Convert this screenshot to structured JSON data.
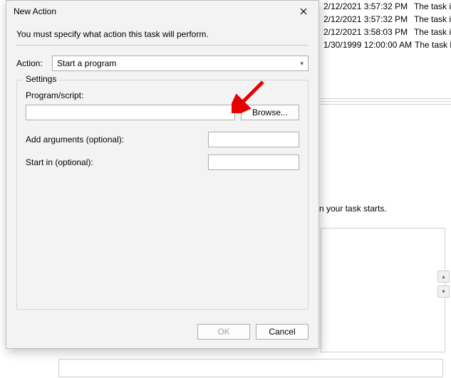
{
  "dialog": {
    "title": "New Action",
    "instruction": "You must specify what action this task will perform.",
    "action_label": "Action:",
    "action_value": "Start a program",
    "settings_legend": "Settings",
    "program_label": "Program/script:",
    "program_value": "",
    "browse_label": "Browse...",
    "arguments_label": "Add arguments (optional):",
    "arguments_value": "",
    "startin_label": "Start in (optional):",
    "startin_value": "",
    "ok_label": "OK",
    "cancel_label": "Cancel"
  },
  "background": {
    "rows": [
      {
        "date": "2/12/2021 3:57:32 PM",
        "task": "The task i"
      },
      {
        "date": "2/12/2021 3:57:32 PM",
        "task": "The task i"
      },
      {
        "date": "2/12/2021 3:58:03 PM",
        "task": "The task i"
      },
      {
        "date": "1/30/1999 12:00:00 AM",
        "task": "The task h"
      }
    ],
    "frag1": "n your task starts."
  }
}
